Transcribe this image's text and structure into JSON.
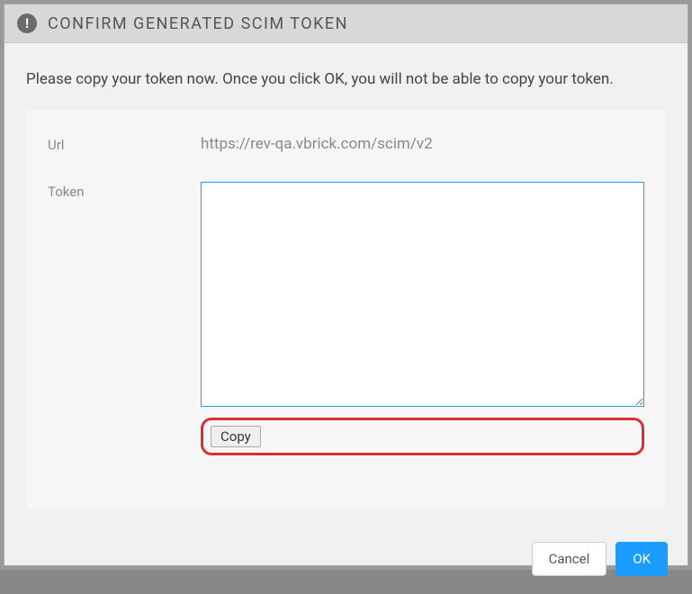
{
  "header": {
    "icon_glyph": "!",
    "title": "CONFIRM GENERATED SCIM TOKEN"
  },
  "body": {
    "instruction": "Please copy your token now. Once you click OK, you will not be able to copy your token.",
    "url_label": "Url",
    "url_value": "https://rev-qa.vbrick.com/scim/v2",
    "token_label": "Token",
    "token_value": "",
    "copy_label": "Copy"
  },
  "footer": {
    "cancel_label": "Cancel",
    "ok_label": "OK"
  }
}
